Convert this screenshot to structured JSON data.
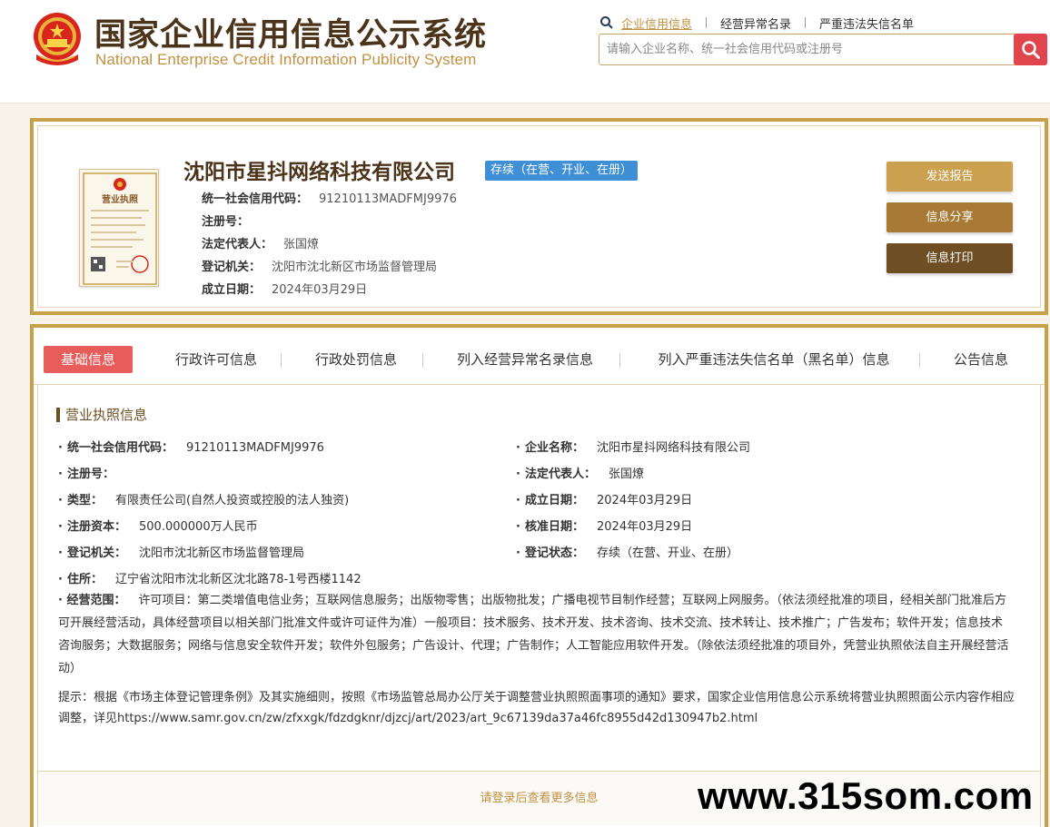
{
  "header": {
    "title": "国家企业信用信息公示系统",
    "subtitle": "National Enterprise Credit Information Publicity System",
    "quicklinks": [
      "企业信用信息",
      "经营异常名录",
      "严重违法失信名单"
    ],
    "search_placeholder": "请输入企业名称、统一社会信用代码或注册号"
  },
  "company": {
    "license_title": "营业执照",
    "name": "沈阳市星抖网络科技有限公司",
    "status": "存续（在营、开业、在册）",
    "rows": [
      {
        "label": "统一社会信用代码：",
        "value": "91210113MADFMJ9976"
      },
      {
        "label": "注册号：",
        "value": ""
      },
      {
        "label": "法定代表人：",
        "value": "张国燎"
      },
      {
        "label": "登记机关：",
        "value": "沈阳市沈北新区市场监督管理局"
      },
      {
        "label": "成立日期：",
        "value": "2024年03月29日"
      }
    ],
    "actions": {
      "send": "发送报告",
      "share": "信息分享",
      "print": "信息打印"
    }
  },
  "tabs": [
    "基础信息",
    "行政许可信息",
    "行政处罚信息",
    "列入经营异常名录信息",
    "列入严重违法失信名单（黑名单）信息",
    "公告信息"
  ],
  "license_info": {
    "section_title": "营业执照信息",
    "left": [
      {
        "label": "统一社会信用代码：",
        "value": "91210113MADFMJ9976"
      },
      {
        "label": "注册号：",
        "value": ""
      },
      {
        "label": "类型：",
        "value": "有限责任公司(自然人投资或控股的法人独资)"
      },
      {
        "label": "注册资本：",
        "value": "500.000000万人民币"
      },
      {
        "label": "登记机关：",
        "value": "沈阳市沈北新区市场监督管理局"
      },
      {
        "label": "住所：",
        "value": "辽宁省沈阳市沈北新区沈北路78-1号西楼1142"
      }
    ],
    "right": [
      {
        "label": "企业名称：",
        "value": "沈阳市星抖网络科技有限公司"
      },
      {
        "label": "法定代表人：",
        "value": "张国燎"
      },
      {
        "label": "成立日期：",
        "value": "2024年03月29日"
      },
      {
        "label": "核准日期：",
        "value": "2024年03月29日"
      },
      {
        "label": "登记状态：",
        "value": "存续（在营、开业、在册）"
      }
    ],
    "scope_label": "经营范围：",
    "scope_value": "许可项目：第二类增值电信业务；互联网信息服务；出版物零售；出版物批发；广播电视节目制作经营；互联网上网服务。（依法须经批准的项目，经相关部门批准后方可开展经营活动，具体经营项目以相关部门批准文件或许可证件为准）一般项目：技术服务、技术开发、技术咨询、技术交流、技术转让、技术推广；广告发布；软件开发；信息技术咨询服务；大数据服务；网络与信息安全软件开发；软件外包服务；广告设计、代理；广告制作；人工智能应用软件开发。（除依法须经批准的项目外，凭营业执照依法自主开展经营活动）",
    "notice": "提示：根据《市场主体登记管理条例》及其实施细则，按照《市场监管总局办公厅关于调整营业执照照面事项的通知》要求，国家企业信用信息公示系统将营业执照照面公示内容作相应调整，详见https://www.samr.gov.cn/zw/zfxxgk/fdzdgknr/djzcj/art/2023/art_9c67139da37a46fc8955d42d130947b2.html"
  },
  "login_hint": "请登录后查看更多信息",
  "watermark": "www.315som.com",
  "colors": {
    "gold": "#c8a04a",
    "brown": "#4b3419",
    "red": "#e95c5c",
    "blue": "#3e8fd6"
  }
}
